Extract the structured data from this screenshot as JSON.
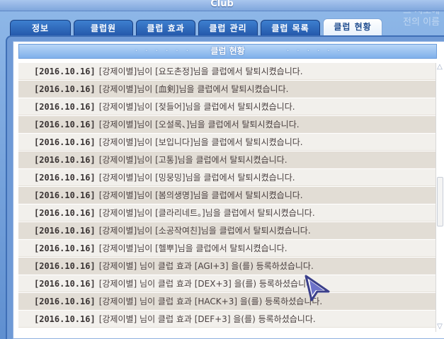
{
  "window": {
    "title": "Club"
  },
  "background_text": "그 시조에\n전의 이름",
  "tabs": [
    {
      "label": "정보",
      "active": false
    },
    {
      "label": "클럽원",
      "active": false
    },
    {
      "label": "클럽 효과",
      "active": false
    },
    {
      "label": "클럽 관리",
      "active": false
    },
    {
      "label": "클럽 목록",
      "active": false
    },
    {
      "label": "클럽 현황",
      "active": true
    }
  ],
  "section": {
    "title": "클럽 현황"
  },
  "log": [
    {
      "date": "[2016.10.16]",
      "text": "[강제이별]님이 [요도촌정]님을 클럽에서 탈퇴시켰습니다."
    },
    {
      "date": "[2016.10.16]",
      "text": "[강제이별]님이 [血剣]님을 클럽에서 탈퇴시켰습니다."
    },
    {
      "date": "[2016.10.16]",
      "text": "[강제이별]님이 [젖들어]님을 클럽에서 탈퇴시켰습니다."
    },
    {
      "date": "[2016.10.16]",
      "text": "[강제이별]님이 [오설록、]님을 클럽에서 탈퇴시켰습니다."
    },
    {
      "date": "[2016.10.16]",
      "text": "[강제이별]님이 [보입니다]님을 클럽에서 탈퇴시켰습니다."
    },
    {
      "date": "[2016.10.16]",
      "text": "[강제이별]님이 [고통]님을 클럽에서 탈퇴시켰습니다."
    },
    {
      "date": "[2016.10.16]",
      "text": "[강제이별]님이 [밍뭉밍]님을 클럽에서 탈퇴시켰습니다."
    },
    {
      "date": "[2016.10.16]",
      "text": "[강제이별]님이 [봄의생명]님을 클럽에서 탈퇴시켰습니다."
    },
    {
      "date": "[2016.10.16]",
      "text": "[강제이별]님이 [클라리네트。]님을 클럽에서 탈퇴시켰습니다."
    },
    {
      "date": "[2016.10.16]",
      "text": "[강제이별]님이 [소공작여친]님을 클럽에서 탈퇴시켰습니다."
    },
    {
      "date": "[2016.10.16]",
      "text": "[강제이별]님이 [헬뿌]님을 클럽에서 탈퇴시켰습니다."
    },
    {
      "date": "[2016.10.16]",
      "text": "[강제이별] 님이 클럽 효과 [AGI+3] 을(를) 등록하셨습니다."
    },
    {
      "date": "[2016.10.16]",
      "text": "[강제이별] 님이 클럽 효과 [DEX+3] 을(를) 등록하셨습니다."
    },
    {
      "date": "[2016.10.16]",
      "text": "[강제이별] 님이 클럽 효과 [HACK+3] 을(를) 등록하셨습니다."
    },
    {
      "date": "[2016.10.16]",
      "text": "[강제이별] 님이 클럽 효과 [DEF+3] 을(를) 등록하셨습니다."
    }
  ],
  "icons": {
    "scroll_up": "scroll-up-arrow-icon",
    "scroll_down": "scroll-down-arrow-icon",
    "cursor": "cursor-arrow-icon"
  },
  "colors": {
    "tab_blue": "#2356a8",
    "header_blue": "#7fb0ea",
    "row_light": "#f2f0ec",
    "row_dark": "#e2ddd5"
  }
}
